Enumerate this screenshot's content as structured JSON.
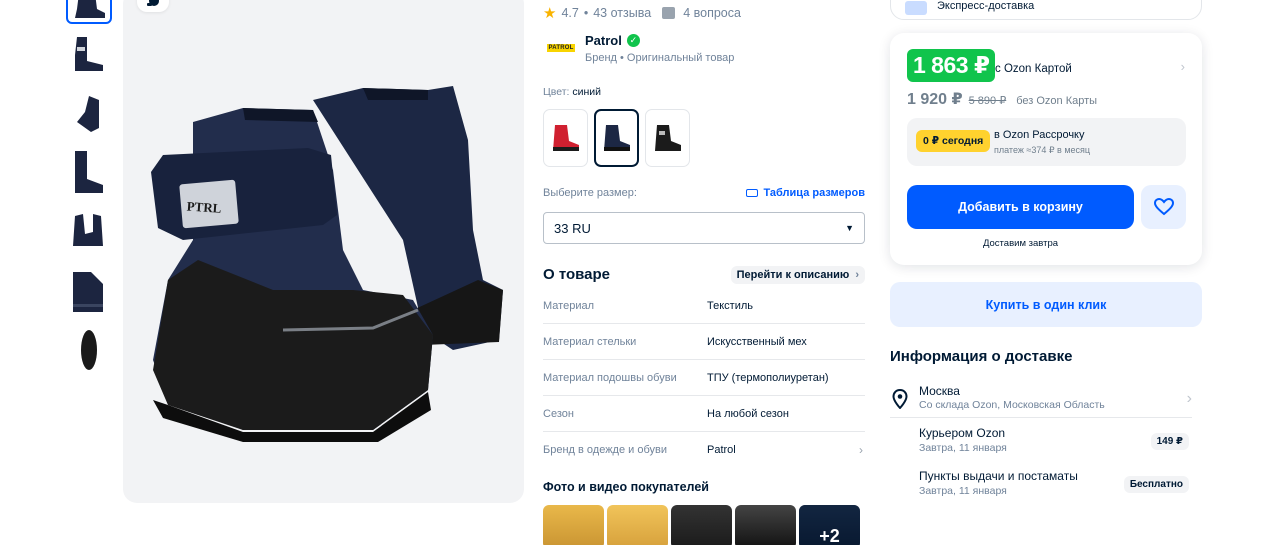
{
  "rating": {
    "score": "4.7",
    "separator": "•",
    "reviews": "43 отзыва",
    "questions": "4 вопроса"
  },
  "brand": {
    "logo_text": "PATROL",
    "name": "Patrol",
    "subtitle": "Бренд • Оригинальный товар"
  },
  "color": {
    "label": "Цвет:",
    "value": "синий",
    "swatches": [
      "red",
      "navy",
      "black"
    ]
  },
  "size": {
    "label": "Выберите размер:",
    "table_link": "Таблица размеров",
    "selected": "33 RU"
  },
  "about": {
    "title": "О товаре",
    "link": "Перейти к описанию",
    "specs": [
      {
        "k": "Материал",
        "v": "Текстиль"
      },
      {
        "k": "Материал стельки",
        "v": "Искусственный мех"
      },
      {
        "k": "Материал подошвы обуви",
        "v": "ТПУ (термополиуретан)"
      },
      {
        "k": "Сезон",
        "v": "На любой сезон"
      },
      {
        "k": "Бренд в одежде и обуви",
        "v": "Patrol"
      }
    ]
  },
  "photos": {
    "title": "Фото и видео покупателей",
    "more": "+2"
  },
  "product": {
    "badge_text": "PTRL"
  },
  "top_card": {
    "text": "Экспресс-доставка"
  },
  "price": {
    "ozon_card_price": "1 863 ₽",
    "ozon_card_label": "с Ozon Картой",
    "regular_price": "1 920 ₽",
    "old_price": "5 890 ₽",
    "regular_label": "без Ozon Карты"
  },
  "installment": {
    "badge": "0 ₽ сегодня",
    "title": "в Ozon Рассрочку",
    "subtitle": "платеж ≈374 ₽ в месяц"
  },
  "cart": {
    "add_label": "Добавить в корзину",
    "delivery_note": "Доставим завтра"
  },
  "one_click": "Купить в один клик",
  "delivery": {
    "title": "Информация о доставке",
    "city": "Москва",
    "warehouse": "Со склада Ozon, Московская Область",
    "options": [
      {
        "name": "Курьером Ozon",
        "date": "Завтра, 11 января",
        "price": "149 ₽"
      },
      {
        "name": "Пункты выдачи и постаматы",
        "date": "Завтра, 11 января",
        "price": "Бесплатно"
      }
    ]
  },
  "colors": {
    "accent": "#005bff",
    "green_price": "#10c44c",
    "installment_badge": "#ffd22e",
    "star": "#f9b300"
  }
}
